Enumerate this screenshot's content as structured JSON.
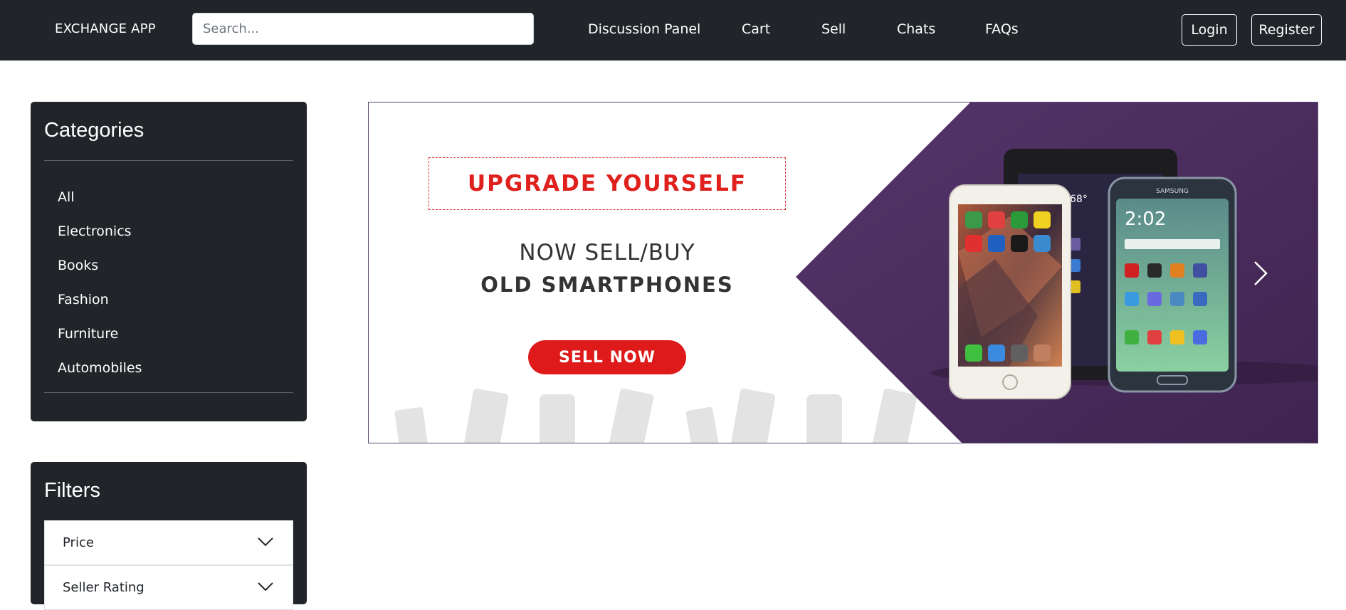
{
  "navbar": {
    "brand": "EXCHANGE APP",
    "search_placeholder": "Search...",
    "links": [
      "Discussion Panel",
      "Cart",
      "Sell",
      "Chats",
      "FAQs"
    ],
    "login_label": "Login",
    "register_label": "Register"
  },
  "sidebar": {
    "categories_title": "Categories",
    "categories": [
      "All",
      "Electronics",
      "Books",
      "Fashion",
      "Furniture",
      "Automobiles"
    ],
    "filters_title": "Filters",
    "filters": [
      "Price",
      "Seller Rating"
    ]
  },
  "banner": {
    "headline": "UPGRADE YOURSELF",
    "line1": "NOW SELL/BUY",
    "line2": "OLD SMARTPHONES",
    "cta_label": "SELL NOW",
    "phone_brand": "SAMSUNG",
    "phone_clock_1": "2:02",
    "phone_clock_2": "68°",
    "next_icon": "chevron-right-icon"
  },
  "colors": {
    "navbar_bg": "#212529",
    "card_bg": "#212529",
    "banner_purple": "#4a2d5c",
    "accent_red": "#de1a1a"
  }
}
